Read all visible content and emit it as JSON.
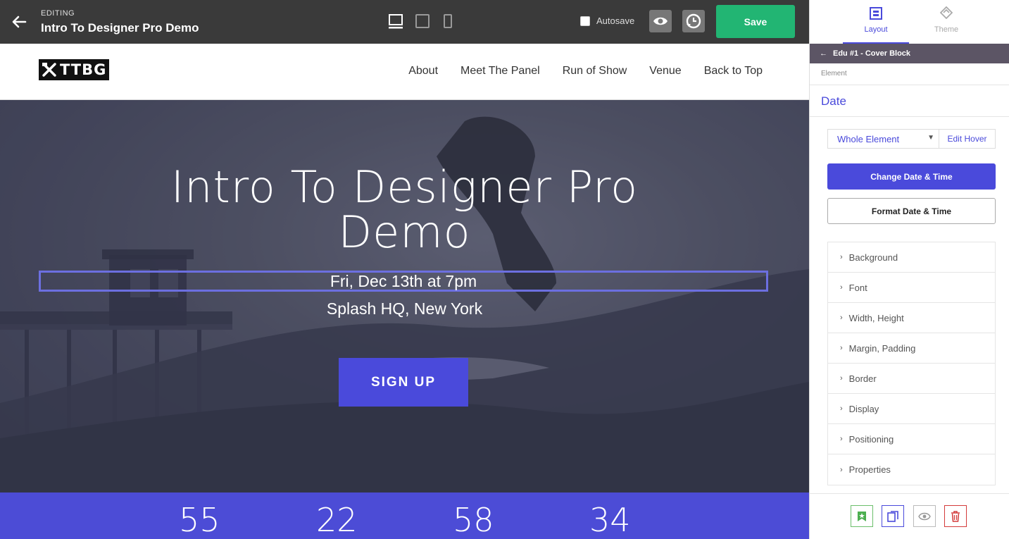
{
  "topbar": {
    "editing_label": "EDITING",
    "title": "Intro To Designer Pro Demo",
    "autosave_label": "Autosave",
    "save_label": "Save",
    "colors": {
      "bar": "#3a3a3a",
      "save": "#22b573"
    }
  },
  "site": {
    "logo_text": "TTBG",
    "nav": [
      "About",
      "Meet The Panel",
      "Run of Show",
      "Venue",
      "Back to Top"
    ]
  },
  "hero": {
    "title_line1": "Intro To Designer Pro",
    "title_line2": "Demo",
    "date": "Fri, Dec 13th at 7pm",
    "location": "Splash HQ, New York",
    "signup_label": "SIGN UP",
    "accent": "#4a4adb"
  },
  "countdown": [
    "55",
    "22",
    "58",
    "34"
  ],
  "panel": {
    "tabs": [
      {
        "label": "Layout",
        "icon": "layout-icon",
        "active": true
      },
      {
        "label": "Theme",
        "icon": "theme-icon",
        "active": false
      }
    ],
    "breadcrumb": "Edu #1 - Cover Block",
    "element_label": "Element",
    "element_name": "Date",
    "select_value": "Whole Element",
    "edit_hover_label": "Edit Hover",
    "change_btn": "Change Date & Time",
    "format_btn": "Format Date & Time",
    "sections": [
      "Background",
      "Font",
      "Width, Height",
      "Margin, Padding",
      "Border",
      "Display",
      "Positioning",
      "Properties"
    ]
  }
}
